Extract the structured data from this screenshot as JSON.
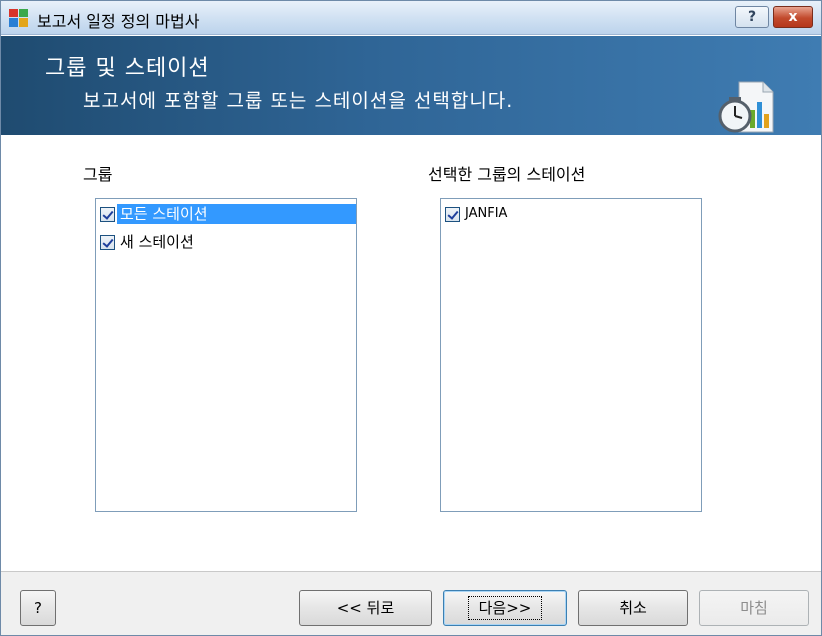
{
  "window": {
    "title": "보고서 일정 정의 마법사",
    "help_button": "?",
    "close_button": "x"
  },
  "banner": {
    "title": "그룹 및 스테이션",
    "subtitle": "보고서에 포함할 그룹 또는 스테이션을 선택합니다."
  },
  "groups": {
    "label": "그룹",
    "items": [
      {
        "label": "모든 스테이션",
        "checked": true,
        "selected": true
      },
      {
        "label": "새 스테이션",
        "checked": true,
        "selected": false
      }
    ]
  },
  "stations": {
    "label": "선택한 그룹의 스테이션",
    "items": [
      {
        "label": "JANFIA",
        "checked": true
      }
    ]
  },
  "footer": {
    "help_label": "?",
    "back_label": "<< 뒤로",
    "next_label": "다음>>",
    "cancel_label": "취소",
    "finish_label": "마침"
  },
  "colors": {
    "banner": "#2f6596",
    "selection": "#3399ff",
    "close": "#c24a2d"
  }
}
